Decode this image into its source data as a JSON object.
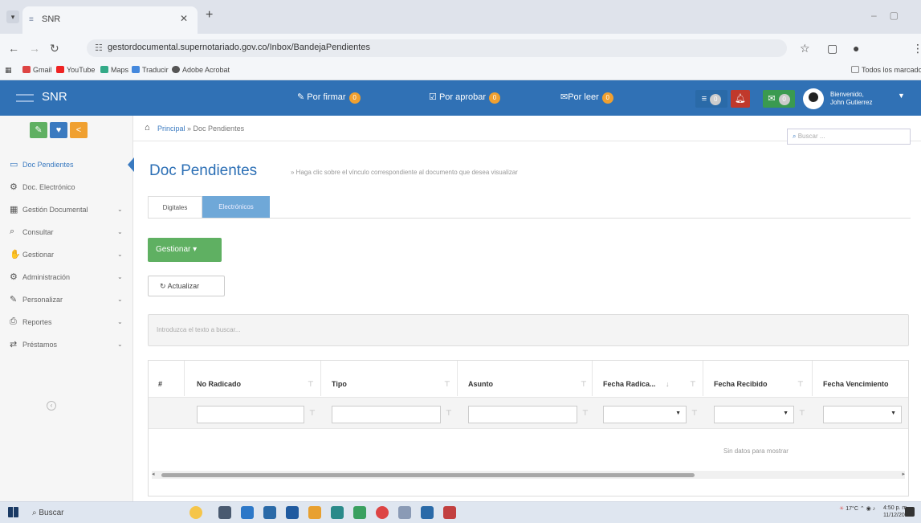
{
  "browser": {
    "tab_title": "SNR",
    "url": "gestordocumental.supernotariado.gov.co/Inbox/BandejaPendientes",
    "bookmarks": [
      {
        "label": "Gmail",
        "color": "#d44"
      },
      {
        "label": "YouTube",
        "color": "#e22"
      },
      {
        "label": "Maps",
        "color": "#3a8"
      },
      {
        "label": "Traducir",
        "color": "#48d"
      },
      {
        "label": "Adobe Acrobat",
        "color": "#555"
      }
    ],
    "all_bookmarks_label": "Todos los marcadores"
  },
  "navbar": {
    "brand": "SNR",
    "links": [
      {
        "icon": "✎",
        "label": "Por firmar",
        "badge": "0"
      },
      {
        "icon": "☑",
        "label": "Por aprobar",
        "badge": "0"
      },
      {
        "icon": "✉",
        "label": "Por leer",
        "badge": "0"
      }
    ],
    "icon_badges": [
      "0",
      "0"
    ],
    "welcome": "Bienvenido,",
    "user": "John Gutierrez"
  },
  "sidebar": {
    "items": [
      {
        "icon": "▭",
        "label": "Doc Pendientes",
        "active": true,
        "chevron": false
      },
      {
        "icon": "⚙",
        "label": "Doc. Electrónico",
        "active": false,
        "chevron": false
      },
      {
        "icon": "▦",
        "label": "Gestión Documental",
        "active": false,
        "chevron": true
      },
      {
        "icon": "⌕",
        "label": "Consultar",
        "active": false,
        "chevron": true
      },
      {
        "icon": "✋",
        "label": "Gestionar",
        "active": false,
        "chevron": true
      },
      {
        "icon": "⚙",
        "label": "Administración",
        "active": false,
        "chevron": true
      },
      {
        "icon": "✎",
        "label": "Personalizar",
        "active": false,
        "chevron": true
      },
      {
        "icon": "⎙",
        "label": "Reportes",
        "active": false,
        "chevron": true
      },
      {
        "icon": "⇄",
        "label": "Préstamos",
        "active": false,
        "chevron": true
      }
    ]
  },
  "breadcrumb": {
    "home": "Principal",
    "current": "Doc Pendientes"
  },
  "search": {
    "placeholder": "Buscar ..."
  },
  "page": {
    "title": "Doc Pendientes",
    "hint": "» Haga clic sobre el vínculo correspondiente al documento que desea visualizar",
    "tabs": [
      "Digitales",
      "Electrónicos"
    ],
    "gestionar": "Gestionar",
    "actualizar": "Actualizar",
    "filter_placeholder": "Introduzca el texto a buscar..."
  },
  "grid": {
    "columns": [
      "#",
      "No Radicado",
      "Tipo",
      "Asunto",
      "Fecha Radica...",
      "Fecha Recibido",
      "Fecha Vencimiento"
    ],
    "empty": "Sin datos para mostrar"
  },
  "taskbar": {
    "search": "Buscar",
    "temp": "17°C",
    "time": "4:50 p. m.",
    "date": "11/12/2025"
  }
}
